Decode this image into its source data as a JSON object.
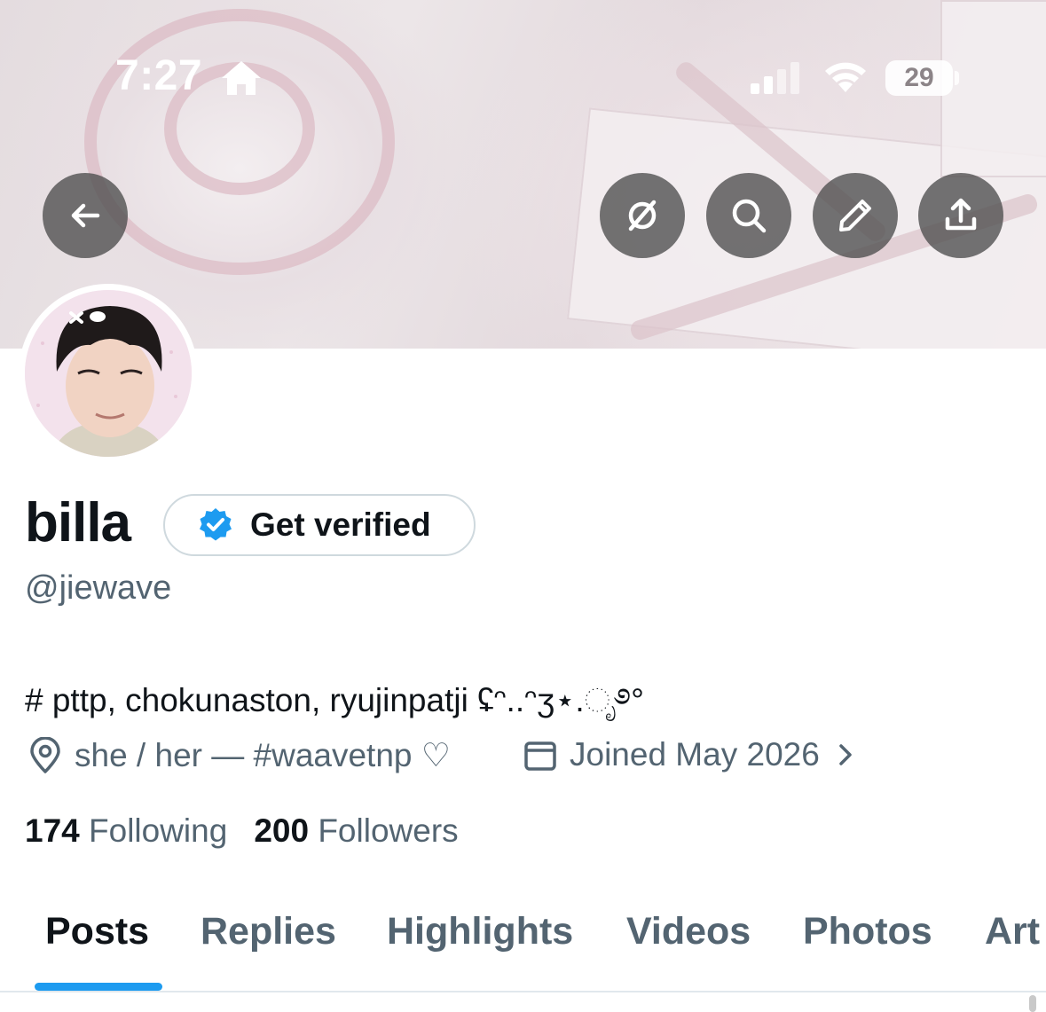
{
  "status_bar": {
    "time": "7:27",
    "battery": "29",
    "icons": [
      "home-icon",
      "signal-icon",
      "wifi-icon",
      "battery-icon"
    ]
  },
  "header": {
    "buttons": [
      {
        "name": "back-button",
        "icon": "arrow-left-icon"
      },
      {
        "name": "grok-button",
        "icon": "slashed-circle-icon"
      },
      {
        "name": "search-button",
        "icon": "search-icon"
      },
      {
        "name": "edit-button",
        "icon": "pencil-icon"
      },
      {
        "name": "share-button",
        "icon": "upload-icon"
      }
    ]
  },
  "profile": {
    "display_name": "billa",
    "verify_label": "Get verified",
    "handle": "@jiewave",
    "bio": "# pttp, chokunaston, ryujinpatji ʢᵔ..ᵔʒ⋆.ೃ࿔°",
    "location": "she / her — #waavetnp ♡",
    "joined": "Joined May 2026",
    "following_count": "174",
    "following_label": "Following",
    "followers_count": "200",
    "followers_label": "Followers"
  },
  "tabs": [
    {
      "label": "Posts",
      "active": true
    },
    {
      "label": "Replies",
      "active": false
    },
    {
      "label": "Highlights",
      "active": false
    },
    {
      "label": "Videos",
      "active": false
    },
    {
      "label": "Photos",
      "active": false
    },
    {
      "label": "Art",
      "active": false
    }
  ],
  "colors": {
    "accent": "#1d9bf0",
    "text_primary": "#0f1419",
    "text_secondary": "#536471",
    "header_button_bg": "#4d4d4d"
  }
}
